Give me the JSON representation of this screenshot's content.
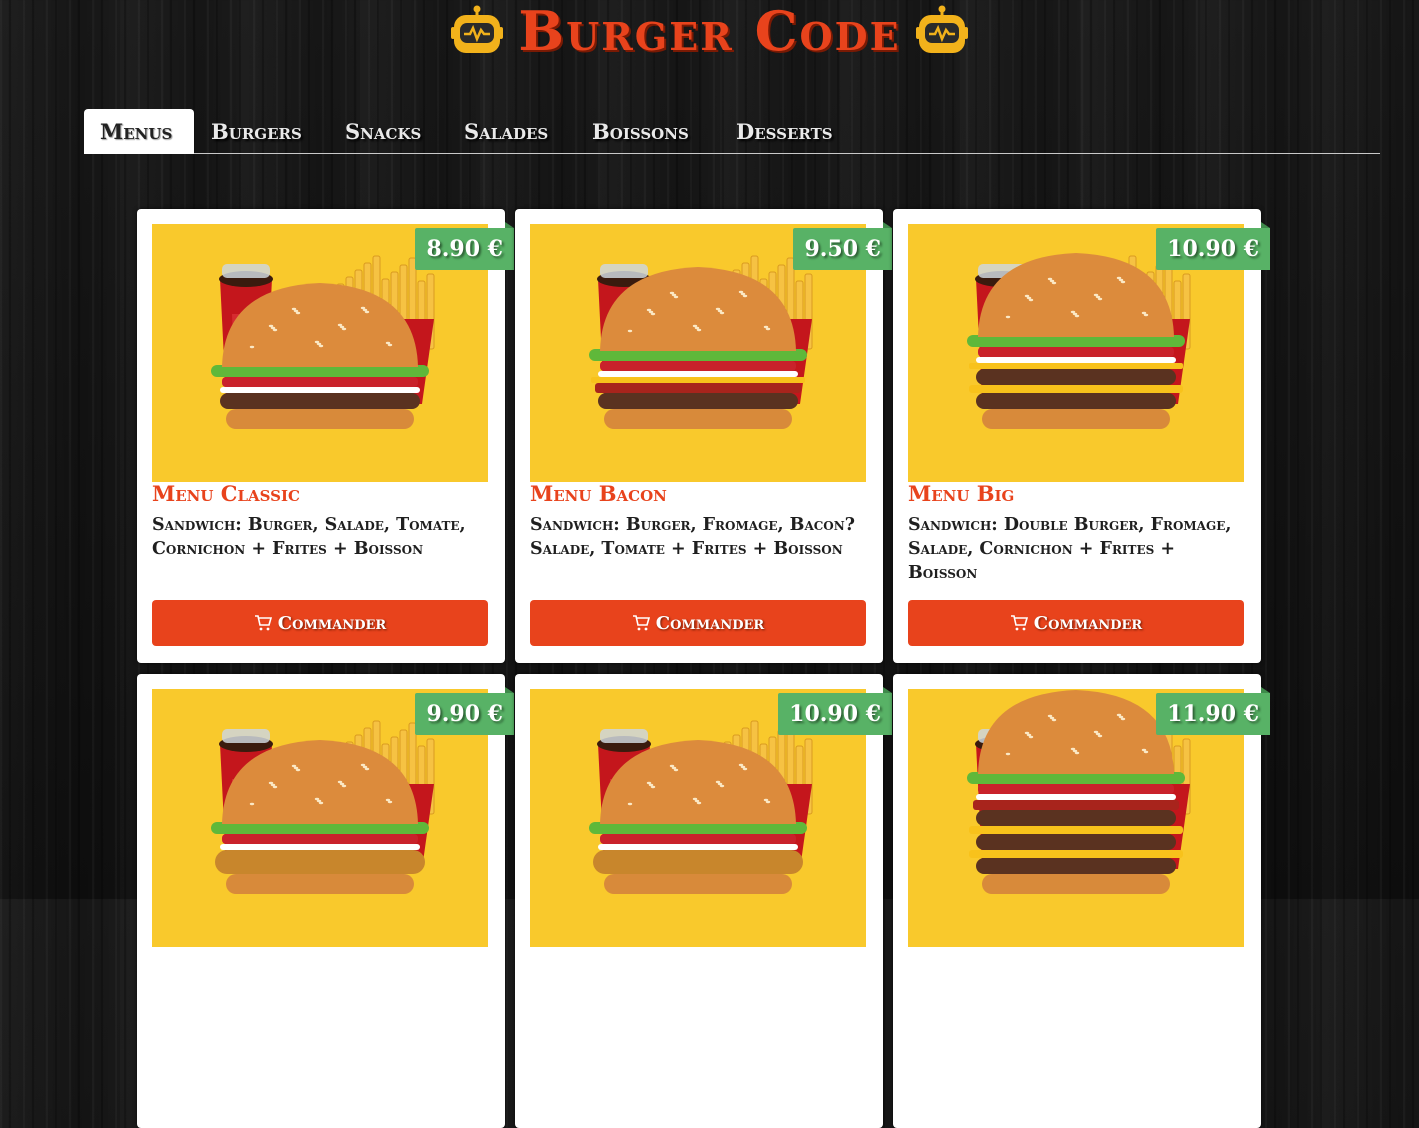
{
  "site": {
    "title": "Burger Code"
  },
  "tabs": [
    {
      "label": "Menus",
      "active": true
    },
    {
      "label": "Burgers",
      "active": false
    },
    {
      "label": "Snacks",
      "active": false
    },
    {
      "label": "Salades",
      "active": false
    },
    {
      "label": "Boissons",
      "active": false
    },
    {
      "label": "Desserts",
      "active": false
    }
  ],
  "order_label": "Commander",
  "products": [
    {
      "name": "Menu Classic",
      "price": "8.90 €",
      "description": "Sandwich: Burger, Salade, Tomate, Cornichon + Frites + Boisson",
      "burger": "classic"
    },
    {
      "name": "Menu Bacon",
      "price": "9.50 €",
      "description": "Sandwich: Burger, Fromage, Bacon? Salade, Tomate + Frites + Boisson",
      "burger": "bacon"
    },
    {
      "name": "Menu Big",
      "price": "10.90 €",
      "description": "Sandwich: Double Burger, Fromage, Salade, Cornichon + Frites + Boisson",
      "burger": "big"
    },
    {
      "name": "",
      "price": "9.90 €",
      "description": "",
      "burger": "chicken"
    },
    {
      "name": "",
      "price": "10.90 €",
      "description": "",
      "burger": "crispy"
    },
    {
      "name": "",
      "price": "11.90 €",
      "description": "",
      "burger": "triple"
    }
  ],
  "colors": {
    "accent": "#e8431c",
    "price_tag": "#58b266",
    "thumb_bg": "#f9c92c"
  },
  "icons": {
    "logo": "robot-icon",
    "cart": "cart-icon"
  }
}
